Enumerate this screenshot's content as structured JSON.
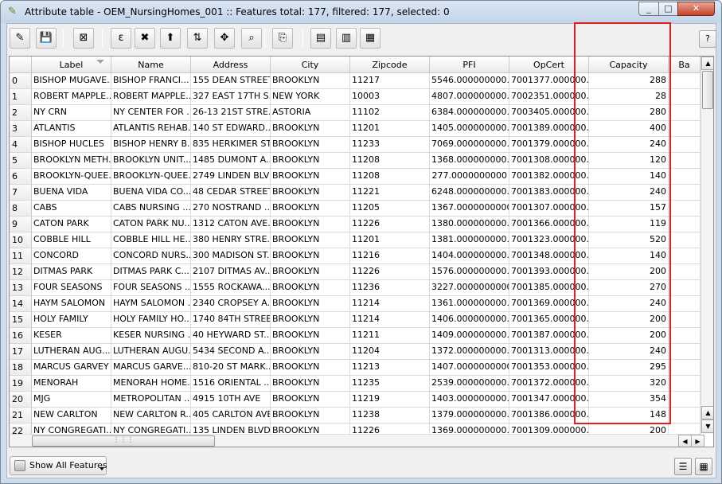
{
  "window": {
    "title": "Attribute table - OEM_NursingHomes_001 :: Features total: 177, filtered: 177, selected: 0",
    "minimize": "_",
    "maximize": "□",
    "close": "✕"
  },
  "toolbar": {
    "icons": [
      "pencil-edit-icon",
      "save-edits-icon",
      "delete-selected-icon",
      "select-by-expression-icon",
      "deselect-all-icon",
      "move-selection-to-top-icon",
      "invert-selection-icon",
      "pan-map-to-selection-icon",
      "zoom-map-to-selection-icon",
      "copy-selected-rows-icon",
      "new-column-icon",
      "delete-column-icon",
      "field-calculator-icon"
    ],
    "help": "?"
  },
  "table": {
    "columns": [
      "Label",
      "Name",
      "Address",
      "City",
      "Zipcode",
      "PFI",
      "OpCert",
      "Capacity",
      "Ba"
    ],
    "rows": [
      {
        "n": "0",
        "label": "BISHOP MUGAVE...",
        "name": "BISHOP FRANCI...",
        "address": "155 DEAN STREET",
        "city": "BROOKLYN",
        "zip": "11217",
        "pfi": "5546.000000000...",
        "opcert": "7001377.000000...",
        "capacity": "288"
      },
      {
        "n": "1",
        "label": "ROBERT MAPPLE...",
        "name": "ROBERT MAPPLE...",
        "address": "327 EAST 17TH S...",
        "city": "NEW YORK",
        "zip": "10003",
        "pfi": "4807.000000000...",
        "opcert": "7002351.000000...",
        "capacity": "28"
      },
      {
        "n": "2",
        "label": "NY CRN",
        "name": "NY CENTER FOR ...",
        "address": "26-13 21ST STRE...",
        "city": "ASTORIA",
        "zip": "11102",
        "pfi": "6384.000000000...",
        "opcert": "7003405.000000...",
        "capacity": "280"
      },
      {
        "n": "3",
        "label": "ATLANTIS",
        "name": "ATLANTIS REHAB...",
        "address": "140 ST EDWARD...",
        "city": "BROOKLYN",
        "zip": "11201",
        "pfi": "1405.000000000...",
        "opcert": "7001389.000000...",
        "capacity": "400"
      },
      {
        "n": "4",
        "label": "BISHOP HUCLES",
        "name": "BISHOP HENRY B...",
        "address": "835 HERKIMER ST",
        "city": "BROOKLYN",
        "zip": "11233",
        "pfi": "7069.000000000...",
        "opcert": "7001379.000000...",
        "capacity": "240"
      },
      {
        "n": "5",
        "label": "BROOKLYN METH...",
        "name": "BROOKLYN UNIT...",
        "address": "1485 DUMONT A...",
        "city": "BROOKLYN",
        "zip": "11208",
        "pfi": "1368.000000000...",
        "opcert": "7001308.000000...",
        "capacity": "120"
      },
      {
        "n": "6",
        "label": "BROOKLYN-QUEE...",
        "name": "BROOKLYN-QUEE...",
        "address": "2749 LINDEN BLVD",
        "city": "BROOKLYN",
        "zip": "11208",
        "pfi": "277.0000000000",
        "opcert": "7001382.000000...",
        "capacity": "140"
      },
      {
        "n": "7",
        "label": "BUENA VIDA",
        "name": "BUENA VIDA CO...",
        "address": "48 CEDAR STREET",
        "city": "BROOKLYN",
        "zip": "11221",
        "pfi": "6248.000000000...",
        "opcert": "7001383.000000...",
        "capacity": "240"
      },
      {
        "n": "8",
        "label": "CABS",
        "name": "CABS NURSING ...",
        "address": "270 NOSTRAND ...",
        "city": "BROOKLYN",
        "zip": "11205",
        "pfi": "1367.0000000000",
        "opcert": "7001307.000000...",
        "capacity": "157"
      },
      {
        "n": "9",
        "label": "CATON PARK",
        "name": "CATON PARK NU...",
        "address": "1312 CATON AVE...",
        "city": "BROOKLYN",
        "zip": "11226",
        "pfi": "1380.000000000...",
        "opcert": "7001366.000000...",
        "capacity": "119"
      },
      {
        "n": "10",
        "label": "COBBLE HILL",
        "name": "COBBLE HILL HE...",
        "address": "380 HENRY STRE...",
        "city": "BROOKLYN",
        "zip": "11201",
        "pfi": "1381.000000000...",
        "opcert": "7001323.000000...",
        "capacity": "520"
      },
      {
        "n": "11",
        "label": "CONCORD",
        "name": "CONCORD NURS...",
        "address": "300 MADISON ST...",
        "city": "BROOKLYN",
        "zip": "11216",
        "pfi": "1404.000000000...",
        "opcert": "7001348.000000...",
        "capacity": "140"
      },
      {
        "n": "12",
        "label": "DITMAS PARK",
        "name": "DITMAS PARK C...",
        "address": "2107 DITMAS AV...",
        "city": "BROOKLYN",
        "zip": "11226",
        "pfi": "1576.000000000...",
        "opcert": "7001393.000000...",
        "capacity": "200"
      },
      {
        "n": "13",
        "label": "FOUR  SEASONS",
        "name": "FOUR SEASONS ...",
        "address": "1555 ROCKAWA...",
        "city": "BROOKLYN",
        "zip": "11236",
        "pfi": "3227.0000000000",
        "opcert": "7001385.000000...",
        "capacity": "270"
      },
      {
        "n": "14",
        "label": "HAYM  SALOMON",
        "name": "HAYM SALOMON ...",
        "address": "2340 CROPSEY A...",
        "city": "BROOKLYN",
        "zip": "11214",
        "pfi": "1361.000000000...",
        "opcert": "7001369.000000...",
        "capacity": "240"
      },
      {
        "n": "15",
        "label": "HOLY  FAMILY",
        "name": "HOLY FAMILY HO...",
        "address": "1740 84TH STREET",
        "city": "BROOKLYN",
        "zip": "11214",
        "pfi": "1406.000000000...",
        "opcert": "7001365.000000...",
        "capacity": "200"
      },
      {
        "n": "16",
        "label": "KESER",
        "name": "KESER NURSING ...",
        "address": "40 HEYWARD ST...",
        "city": "BROOKLYN",
        "zip": "11211",
        "pfi": "1409.000000000...",
        "opcert": "7001387.000000...",
        "capacity": "200"
      },
      {
        "n": "17",
        "label": "LUTHERAN  AUG...",
        "name": "LUTHERAN AUGU...",
        "address": "5434 SECOND A...",
        "city": "BROOKLYN",
        "zip": "11204",
        "pfi": "1372.000000000...",
        "opcert": "7001313.000000...",
        "capacity": "240"
      },
      {
        "n": "18",
        "label": "MARCUS  GARVEY",
        "name": "MARCUS GARVE...",
        "address": "810-20 ST MARK...",
        "city": "BROOKLYN",
        "zip": "11213",
        "pfi": "1407.0000000000",
        "opcert": "7001353.000000...",
        "capacity": "295"
      },
      {
        "n": "19",
        "label": "MENORAH",
        "name": "MENORAH HOME...",
        "address": "1516 ORIENTAL ...",
        "city": "BROOKLYN",
        "zip": "11235",
        "pfi": "2539.000000000...",
        "opcert": "7001372.000000...",
        "capacity": "320"
      },
      {
        "n": "20",
        "label": "MJG",
        "name": "METROPOLITAN ...",
        "address": "4915 10TH AVE",
        "city": "BROOKLYN",
        "zip": "11219",
        "pfi": "1403.000000000...",
        "opcert": "7001347.000000...",
        "capacity": "354"
      },
      {
        "n": "21",
        "label": "NEW CARLTON",
        "name": "NEW CARLTON R...",
        "address": "405 CARLTON AVE",
        "city": "BROOKLYN",
        "zip": "11238",
        "pfi": "1379.000000000...",
        "opcert": "7001386.000000...",
        "capacity": "148"
      },
      {
        "n": "22",
        "label": "NY CONGREGATI...",
        "name": "NY CONGREGATI...",
        "address": "135 LINDEN BLVD",
        "city": "BROOKLYN",
        "zip": "11226",
        "pfi": "1369.000000000...",
        "opcert": "7001309.000000...",
        "capacity": "200"
      }
    ]
  },
  "bottom": {
    "show_all": "Show All Features"
  },
  "colors": {
    "highlight_box": "#e02020",
    "title_bar": "#cfdceb"
  }
}
